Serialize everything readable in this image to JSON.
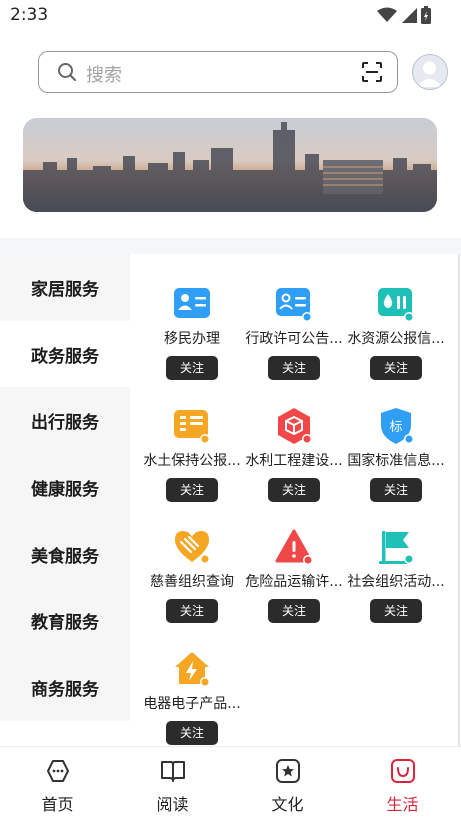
{
  "status_bar": {
    "time": "2:33"
  },
  "search": {
    "placeholder": "搜索"
  },
  "sidebar": {
    "items": [
      {
        "label": "家居服务"
      },
      {
        "label": "政务服务"
      },
      {
        "label": "出行服务"
      },
      {
        "label": "健康服务"
      },
      {
        "label": "美食服务"
      },
      {
        "label": "教育服务"
      },
      {
        "label": "商务服务"
      }
    ],
    "active_index": 1
  },
  "services": {
    "follow_label": "关注",
    "items": [
      {
        "label": "移民办理",
        "icon": "id-card-icon",
        "color": "#2f9ef5"
      },
      {
        "label": "行政许可公告...",
        "icon": "license-icon",
        "color": "#2f9ef5"
      },
      {
        "label": "水资源公报信...",
        "icon": "water-drop-icon",
        "color": "#1fc0b8"
      },
      {
        "label": "水土保持公报...",
        "icon": "document-icon",
        "color": "#f5a623"
      },
      {
        "label": "水利工程建设...",
        "icon": "cube-icon",
        "color": "#f04848"
      },
      {
        "label": "国家标准信息...",
        "icon": "standard-shield-icon",
        "color": "#2f9ef5"
      },
      {
        "label": "慈善组织查询",
        "icon": "heart-hand-icon",
        "color": "#f5a623"
      },
      {
        "label": "危险品运输许...",
        "icon": "warning-icon",
        "color": "#f04848"
      },
      {
        "label": "社会组织活动...",
        "icon": "flag-icon",
        "color": "#1fc0b8"
      },
      {
        "label": "电器电子产品...",
        "icon": "house-bolt-icon",
        "color": "#f5a623"
      }
    ]
  },
  "bottom_nav": {
    "items": [
      {
        "label": "首页",
        "icon": "home-chat-icon"
      },
      {
        "label": "阅读",
        "icon": "book-icon"
      },
      {
        "label": "文化",
        "icon": "star-badge-icon"
      },
      {
        "label": "生活",
        "icon": "smile-bag-icon"
      }
    ],
    "active_index": 3,
    "active_color": "#d7263d"
  }
}
